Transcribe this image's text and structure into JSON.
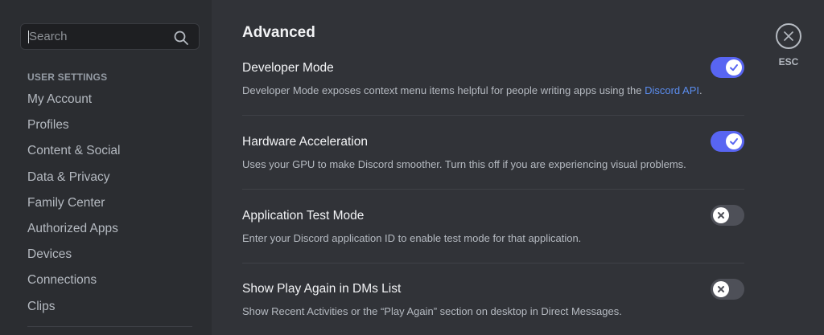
{
  "search": {
    "placeholder": "Search"
  },
  "sidebar": {
    "section_header": "USER SETTINGS",
    "items": [
      {
        "label": "My Account"
      },
      {
        "label": "Profiles"
      },
      {
        "label": "Content & Social"
      },
      {
        "label": "Data & Privacy"
      },
      {
        "label": "Family Center"
      },
      {
        "label": "Authorized Apps"
      },
      {
        "label": "Devices"
      },
      {
        "label": "Connections"
      },
      {
        "label": "Clips"
      }
    ]
  },
  "main": {
    "title": "Advanced",
    "settings": [
      {
        "title": "Developer Mode",
        "desc_before": "Developer Mode exposes context menu items helpful for people writing apps using the ",
        "desc_link": "Discord API",
        "desc_after": ".",
        "enabled": true
      },
      {
        "title": "Hardware Acceleration",
        "desc": "Uses your GPU to make Discord smoother. Turn this off if you are experiencing visual problems.",
        "enabled": true
      },
      {
        "title": "Application Test Mode",
        "desc": "Enter your Discord application ID to enable test mode for that application.",
        "enabled": false
      },
      {
        "title": "Show Play Again in DMs List",
        "desc": "Show Recent Activities or the “Play Again” section on desktop in Direct Messages.",
        "enabled": false
      }
    ]
  },
  "close": {
    "label": "ESC"
  },
  "icons": {
    "search": "search-icon",
    "close": "close-icon",
    "check": "check-icon",
    "x": "x-icon"
  },
  "colors": {
    "accent": "#5865f2",
    "toggle_off": "#4e5058",
    "link": "#5b8dee",
    "sidebar_bg": "#2b2d31",
    "main_bg": "#313338"
  }
}
